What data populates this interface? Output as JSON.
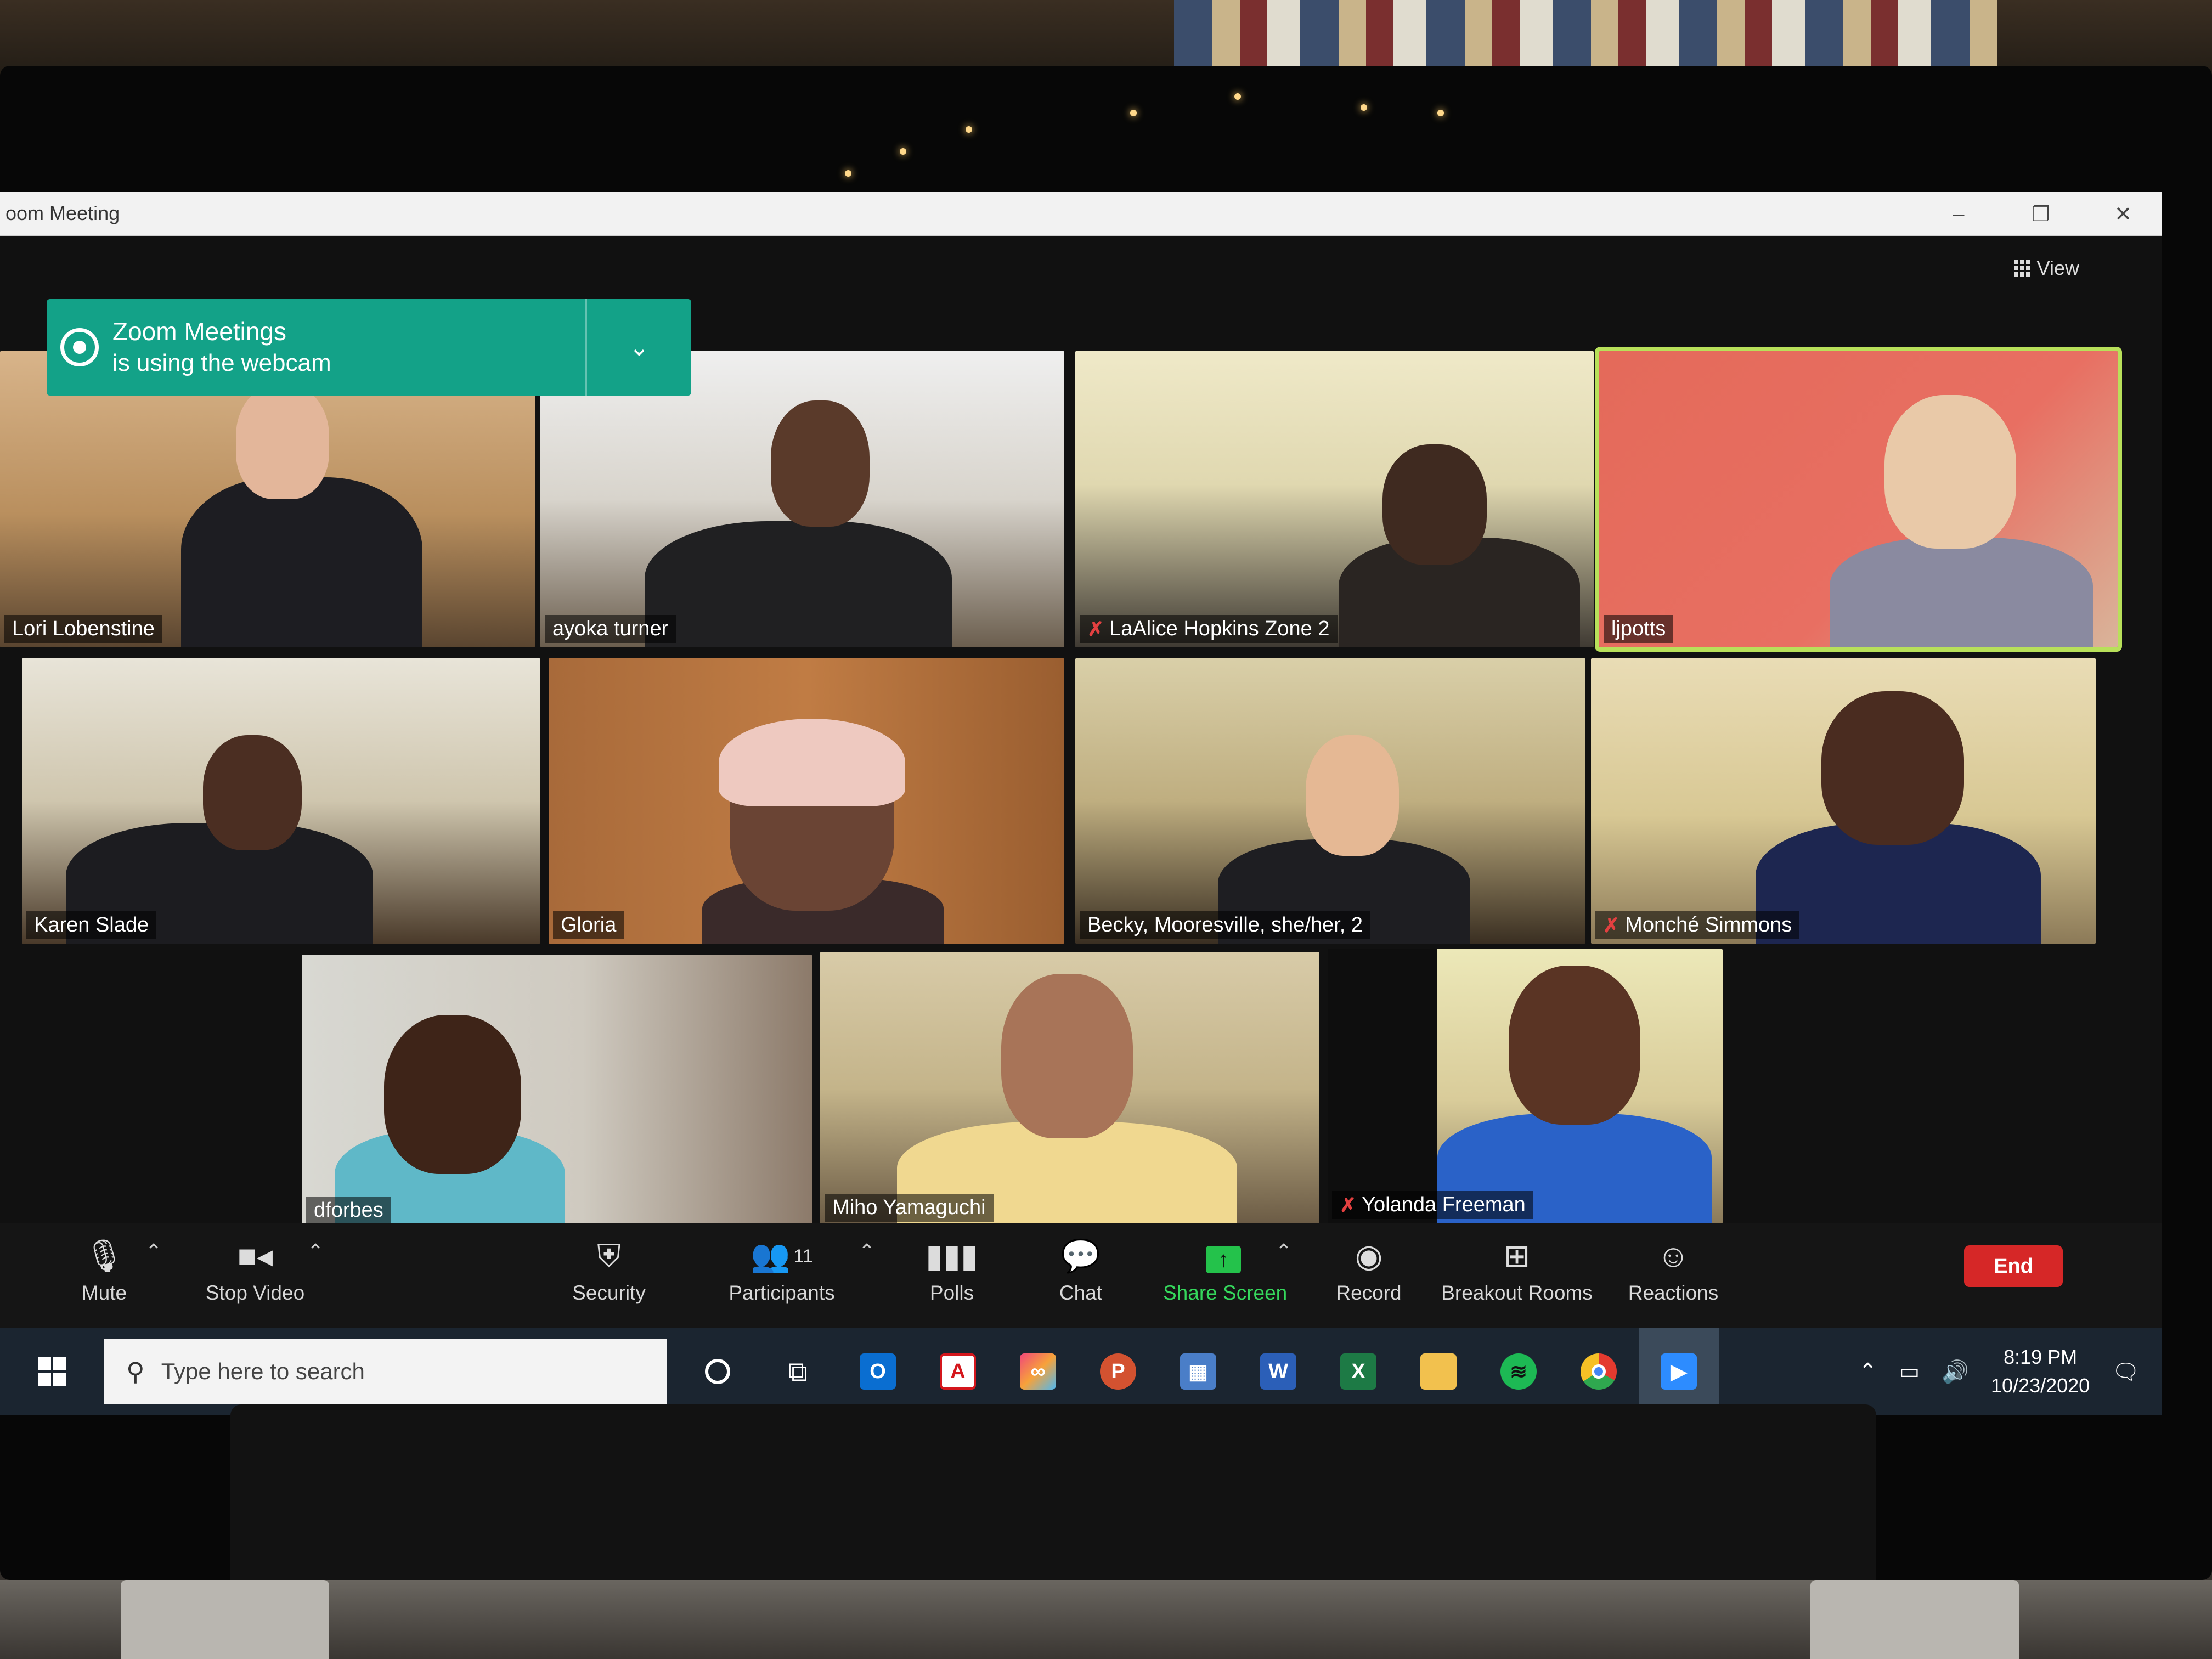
{
  "window": {
    "title": "oom Meeting",
    "view_label": "View"
  },
  "notification": {
    "line1": "Zoom Meetings",
    "line2": "is using the webcam"
  },
  "participants": [
    {
      "name": "Lori Lobenstine",
      "muted": false
    },
    {
      "name": "ayoka turner",
      "muted": false
    },
    {
      "name": "LaAlice Hopkins Zone 2",
      "muted": true
    },
    {
      "name": "ljpotts",
      "muted": false,
      "active_speaker": true
    },
    {
      "name": "Karen Slade",
      "muted": false
    },
    {
      "name": "Gloria",
      "muted": false
    },
    {
      "name": "Becky, Mooresville, she/her, 2",
      "muted": false
    },
    {
      "name": "Monché Simmons",
      "muted": true
    },
    {
      "name": "dforbes",
      "muted": false
    },
    {
      "name": "Miho Yamaguchi",
      "muted": false
    },
    {
      "name": "Yolanda Freeman",
      "muted": true
    }
  ],
  "toolbar": {
    "mute": "Mute",
    "stop_video": "Stop Video",
    "security": "Security",
    "participants": "Participants",
    "participants_count": "11",
    "polls": "Polls",
    "chat": "Chat",
    "share_screen": "Share Screen",
    "record": "Record",
    "breakout_rooms": "Breakout Rooms",
    "reactions": "Reactions",
    "end": "End"
  },
  "taskbar": {
    "search_placeholder": "Type here to search",
    "time": "8:19 PM",
    "date": "10/23/2020",
    "apps": [
      "outlook",
      "acrobat",
      "creative-cloud",
      "powerpoint",
      "calculator",
      "word",
      "excel",
      "file-explorer",
      "spotify",
      "chrome",
      "zoom"
    ]
  },
  "colors": {
    "notification_bg": "#13a288",
    "active_speaker_border": "#b8e05a",
    "end_button": "#d62727",
    "share_screen_green": "#24c24b",
    "muted_red": "#e34040"
  }
}
